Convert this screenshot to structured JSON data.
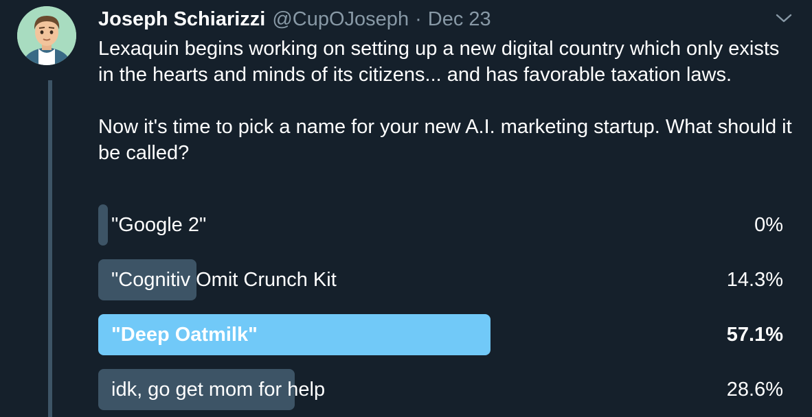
{
  "author": {
    "name": "Joseph Schiarizzi",
    "handle": "@CupOJoseph",
    "separator": "·",
    "date": "Dec 23"
  },
  "tweet": {
    "paragraph1": "Lexaquin begins working on setting up a new digital country which only exists in the hearts and minds of its citizens... and has favorable taxation laws.",
    "paragraph2": "Now it's time to pick a name for your new A.I. marketing startup. What should it be called?"
  },
  "poll": {
    "options": [
      {
        "label": "\"Google 2\"",
        "percent": "0%",
        "value": 0,
        "winner": false
      },
      {
        "label": "\"Cognitiv Omit Crunch Kit",
        "percent": "14.3%",
        "value": 14.3,
        "winner": false
      },
      {
        "label": "\"Deep Oatmilk\"",
        "percent": "57.1%",
        "value": 57.1,
        "winner": true
      },
      {
        "label": "idk, go get mom for help",
        "percent": "28.6%",
        "value": 28.6,
        "winner": false
      }
    ]
  },
  "icons": {
    "avatar": "cartoon-avatar-icon",
    "menu": "chevron-down-icon"
  },
  "colors": {
    "background": "#15202b",
    "muted_text": "#8899a6",
    "bar": "#3d5466",
    "winner_bar": "#71c9f8"
  }
}
